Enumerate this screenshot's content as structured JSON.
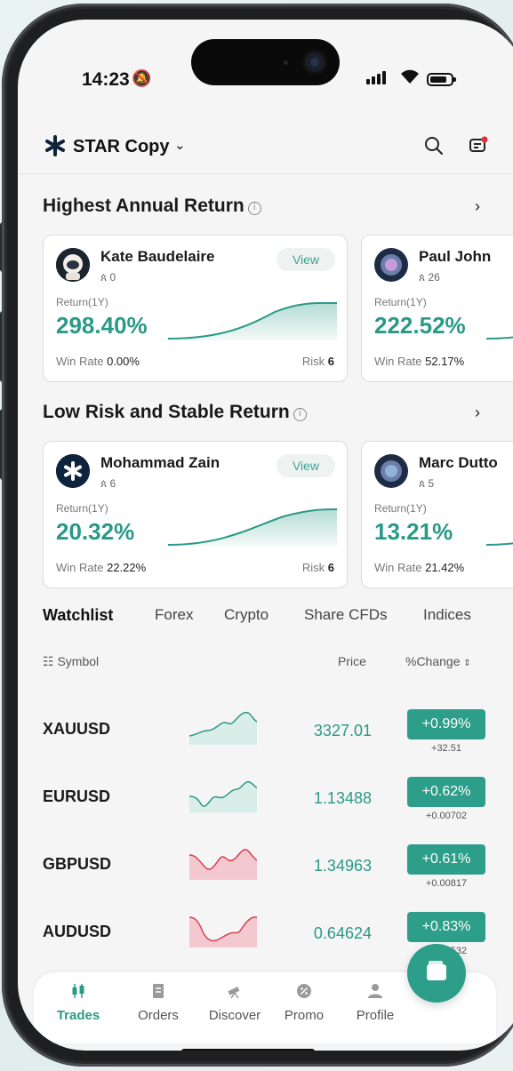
{
  "status": {
    "time": "14:23"
  },
  "header": {
    "brand": "STAR Copy"
  },
  "sections": [
    {
      "title": "Highest Annual Return"
    },
    {
      "title": "Low Risk and Stable Return"
    }
  ],
  "cards": {
    "highest": [
      {
        "name": "Kate Baudelaire",
        "followers": "0",
        "view": "View",
        "return_label": "Return(1Y)",
        "return": "298.40%",
        "winrate_label": "Win Rate",
        "winrate": "0.00%",
        "risk_label": "Risk",
        "risk": "6"
      },
      {
        "name": "Paul John",
        "followers": "26",
        "return_label": "Return(1Y)",
        "return": "222.52%",
        "winrate_label": "Win Rate",
        "winrate": "52.17%"
      }
    ],
    "lowrisk": [
      {
        "name": "Mohammad Zain",
        "followers": "6",
        "view": "View",
        "return_label": "Return(1Y)",
        "return": "20.32%",
        "winrate_label": "Win Rate",
        "winrate": "22.22%",
        "risk_label": "Risk",
        "risk": "6"
      },
      {
        "name": "Marc Dutto",
        "followers": "5",
        "return_label": "Return(1Y)",
        "return": "13.21%",
        "winrate_label": "Win Rate",
        "winrate": "21.42%"
      }
    ]
  },
  "tabs": [
    "Watchlist",
    "Forex",
    "Crypto",
    "Share CFDs",
    "Indices"
  ],
  "columns": {
    "symbol": "Symbol",
    "price": "Price",
    "change": "%Change"
  },
  "rows": [
    {
      "symbol": "XAUUSD",
      "price": "3327.01",
      "change": "+0.99%",
      "change_abs": "+32.51",
      "trend": "up"
    },
    {
      "symbol": "EURUSD",
      "price": "1.13488",
      "change": "+0.62%",
      "change_abs": "+0.00702",
      "trend": "up"
    },
    {
      "symbol": "GBPUSD",
      "price": "1.34963",
      "change": "+0.61%",
      "change_abs": "+0.00817",
      "trend": "down"
    },
    {
      "symbol": "AUDUSD",
      "price": "0.64624",
      "change": "+0.83%",
      "change_abs": "+0.00532",
      "trend": "down"
    }
  ],
  "nav": [
    "Trades",
    "Orders",
    "Discover",
    "Promo",
    "Profile"
  ],
  "colors": {
    "accent": "#2a9a86",
    "change_bg": "#2c9e8a",
    "negative_fill": "#f3c9cf",
    "negative_line": "#d9414f"
  }
}
